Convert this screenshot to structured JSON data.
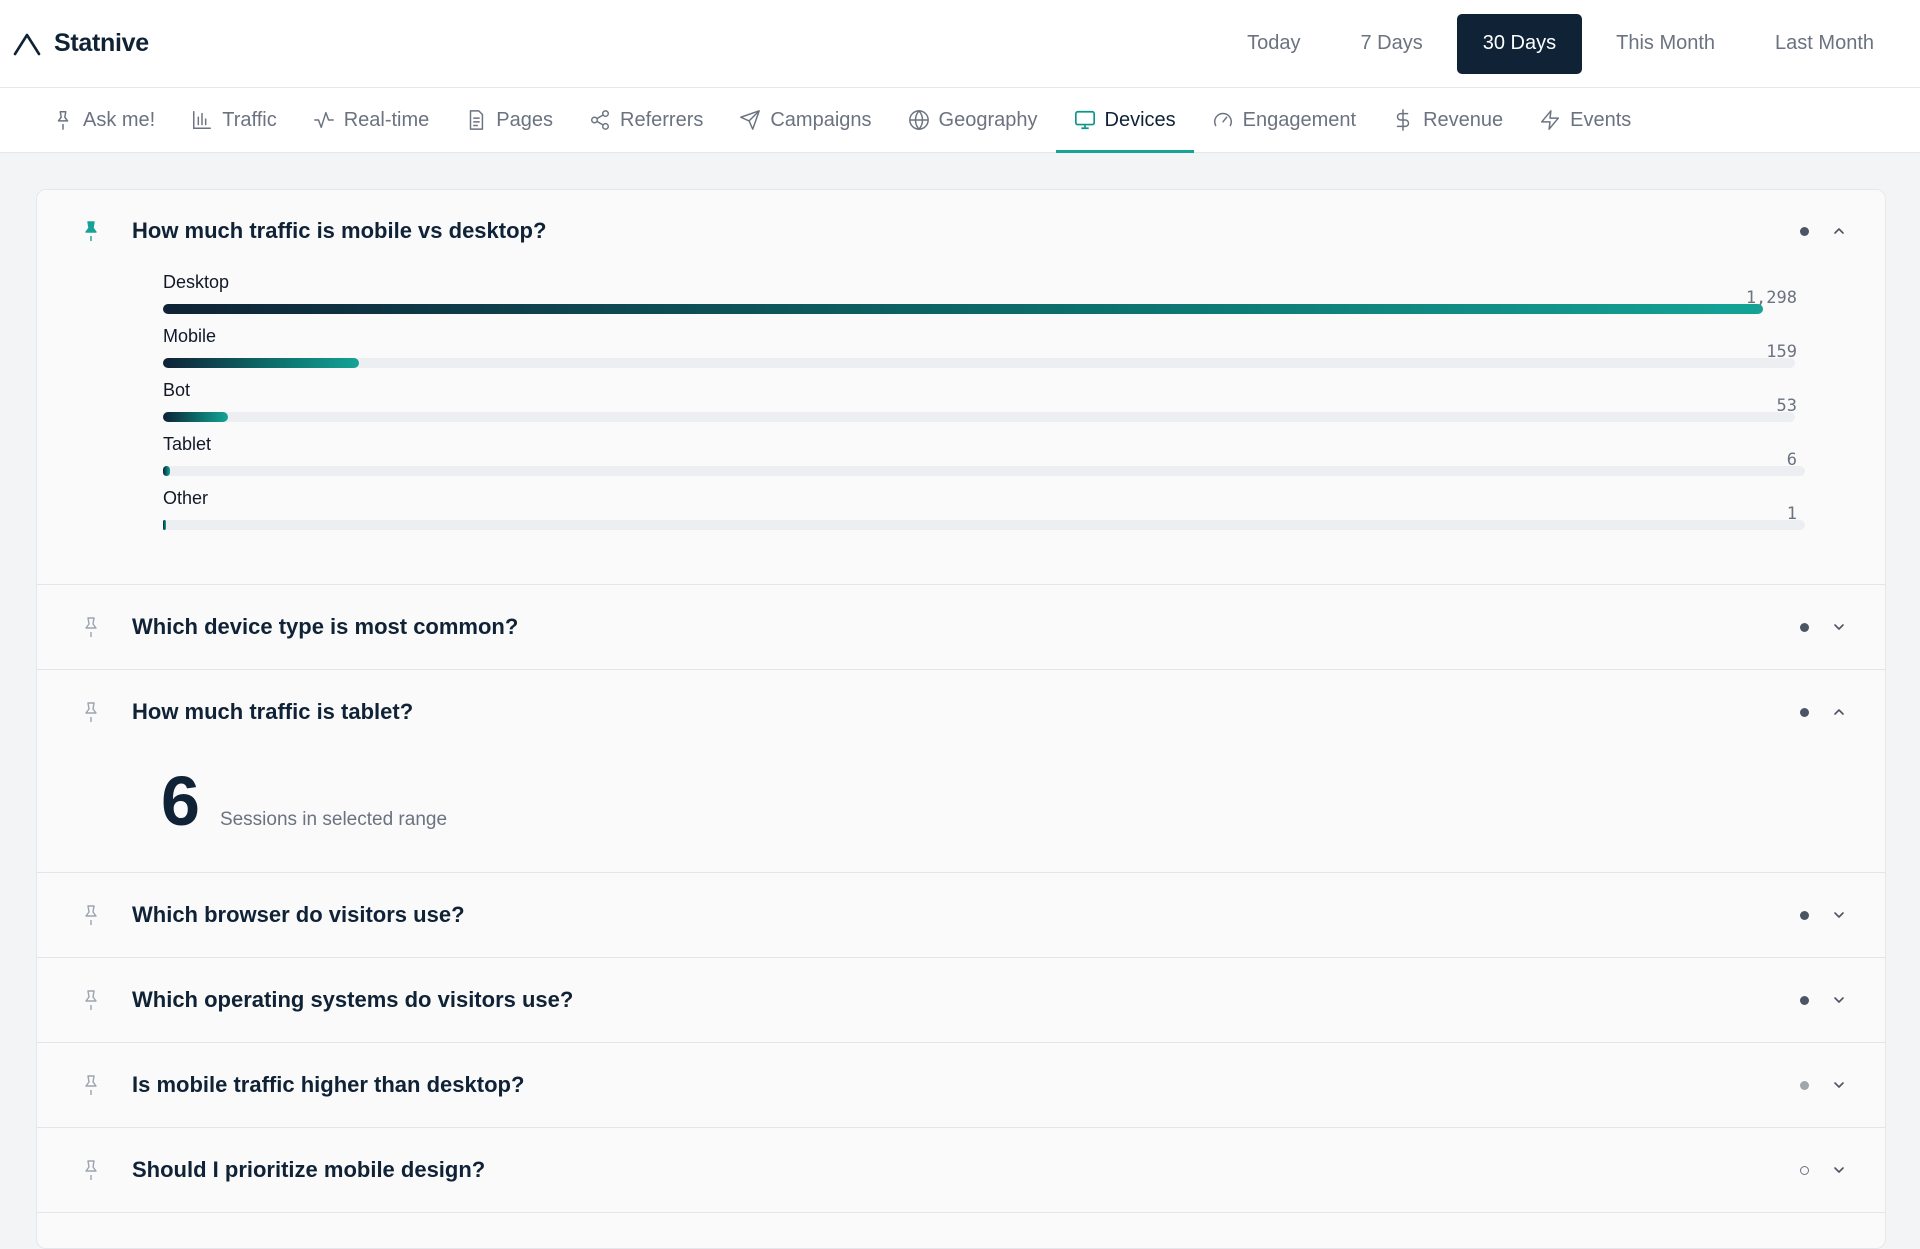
{
  "brand": {
    "name": "Statnive"
  },
  "ranges": [
    "Today",
    "7 Days",
    "30 Days",
    "This Month",
    "Last Month"
  ],
  "active_range": "30 Days",
  "tabs": [
    {
      "label": "Ask me!",
      "icon": "pin-icon"
    },
    {
      "label": "Traffic",
      "icon": "bar-chart-icon"
    },
    {
      "label": "Real-time",
      "icon": "activity-icon"
    },
    {
      "label": "Pages",
      "icon": "file-icon"
    },
    {
      "label": "Referrers",
      "icon": "share-icon"
    },
    {
      "label": "Campaigns",
      "icon": "send-icon"
    },
    {
      "label": "Geography",
      "icon": "globe-icon"
    },
    {
      "label": "Devices",
      "icon": "monitor-icon"
    },
    {
      "label": "Engagement",
      "icon": "gauge-icon"
    },
    {
      "label": "Revenue",
      "icon": "dollar-icon"
    },
    {
      "label": "Events",
      "icon": "zap-icon"
    }
  ],
  "active_tab": "Devices",
  "questions": [
    {
      "title": "How much traffic is mobile vs desktop?",
      "expanded": true,
      "pinned": true
    },
    {
      "title": "Which device type is most common?",
      "expanded": false,
      "pinned": false
    },
    {
      "title": "How much traffic is tablet?",
      "expanded": true,
      "pinned": false
    },
    {
      "title": "Which browser do visitors use?",
      "expanded": false,
      "pinned": false
    },
    {
      "title": "Which operating systems do visitors use?",
      "expanded": false,
      "pinned": false
    },
    {
      "title": "Is mobile traffic higher than desktop?",
      "expanded": false,
      "pinned": false
    },
    {
      "title": "Should I prioritize mobile design?",
      "expanded": false,
      "pinned": false
    }
  ],
  "device_breakdown": {
    "rows": [
      {
        "label": "Desktop",
        "value": 1298,
        "display": "1,298"
      },
      {
        "label": "Mobile",
        "value": 159,
        "display": "159"
      },
      {
        "label": "Bot",
        "value": 53,
        "display": "53"
      },
      {
        "label": "Tablet",
        "value": 6,
        "display": "6"
      },
      {
        "label": "Other",
        "value": 1,
        "display": "1"
      }
    ]
  },
  "tablet_metric": {
    "value": "6",
    "caption": "Sessions in selected range"
  },
  "colors": {
    "accent": "#14a396",
    "navy": "#0f2236"
  }
}
